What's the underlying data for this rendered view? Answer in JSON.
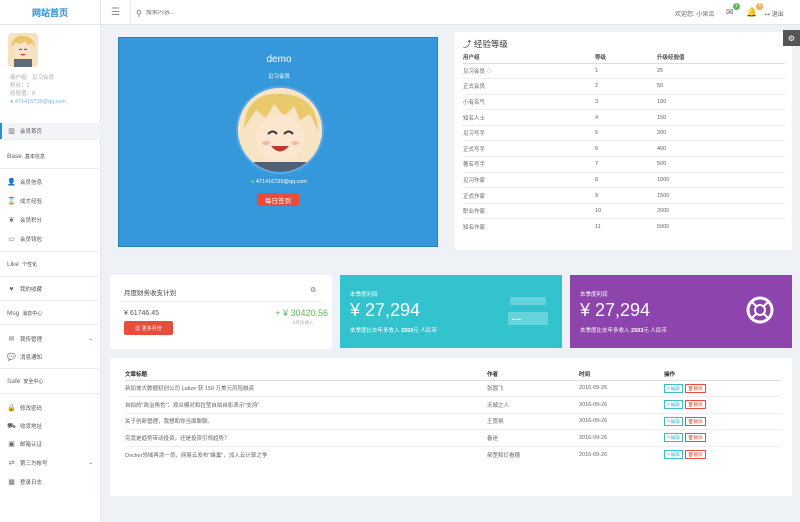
{
  "topbar": {
    "logo": "网站首页",
    "search_placeholder": "搜索内容...",
    "welcome": "欢迎您: 小呆瓜",
    "msg_count": "1",
    "notice_count": "5",
    "logout": "退出"
  },
  "sidebar": {
    "user": {
      "role": "用户组：见习会员",
      "score": "积分：1",
      "exp": "经验值：8",
      "email": "471416739@qq.com"
    },
    "home": "会员首页",
    "groups": [
      {
        "title": "Base",
        "sub": "基本信息",
        "items": [
          "会员信息",
          "成才经验",
          "会员积分",
          "会员钱包"
        ]
      },
      {
        "title": "Like",
        "sub": "个性化",
        "items": [
          "我的收藏"
        ]
      },
      {
        "title": "Msg",
        "sub": "消息中心",
        "items": [
          "我传管理",
          "消息通知"
        ]
      },
      {
        "title": "Safe",
        "sub": "安全中心",
        "items": [
          "修改密码",
          "收货地址",
          "邮箱认证",
          "第三方帐号",
          "登录日志"
        ]
      }
    ]
  },
  "profile": {
    "name": "demo",
    "level": "见习会员",
    "email": "471416739@qq.com",
    "sign_button": "每日签到"
  },
  "exp_table": {
    "title": "经验等级",
    "headers": [
      "用户组",
      "等级",
      "升级经验值"
    ],
    "rows": [
      [
        "见习会员",
        "1",
        "25"
      ],
      [
        "正式会员",
        "2",
        "50"
      ],
      [
        "小有名气",
        "3",
        "100"
      ],
      [
        "知名人士",
        "4",
        "150"
      ],
      [
        "见习写手",
        "5",
        "200"
      ],
      [
        "正式写手",
        "6",
        "400"
      ],
      [
        "著名写手",
        "7",
        "500"
      ],
      [
        "见习作家",
        "8",
        "1000"
      ],
      [
        "正式作家",
        "9",
        "1500"
      ],
      [
        "职业作家",
        "10",
        "2000"
      ],
      [
        "知名作家",
        "11",
        "5000"
      ]
    ]
  },
  "finance": {
    "title": "月度财务收支计划",
    "value1": "¥ 61746.45",
    "value2": "+ ¥ 30420.56",
    "note": "8月份收入",
    "button": "更多月份"
  },
  "cards": [
    {
      "label": "本季度利润",
      "amount": "¥ 27,294",
      "compare_prefix": "本季度比去年多收入",
      "compare_value": "2593",
      "compare_suffix": "元 人民币",
      "color": "#33c3cf"
    },
    {
      "label": "本季度利润",
      "amount": "¥ 27,294",
      "compare_prefix": "本季度比去年多收入",
      "compare_value": "2593",
      "compare_suffix": "元 人民币",
      "color": "#8e44ad"
    }
  ],
  "articles": {
    "headers": [
      "文章标题",
      "作者",
      "时间",
      "操作"
    ],
    "edit": "编辑",
    "delete": "删除",
    "rows": [
      [
        "新加坡大数据初创公司 Latize 获 150 万美元风险融资",
        "张圆飞",
        "2016-09-26"
      ],
      [
        "自拍的\"政治角色\"：观众模对和拉莹自拍自影表示\"支持\"",
        "天城之人",
        "2016-09-26"
      ],
      [
        "关于创新管理，我想和你当面聊聊。",
        "王宽柄",
        "2016-09-26"
      ],
      [
        "究竟是趋势带动投资，还是投资引领趋势？",
        "春迷",
        "2016-09-26"
      ],
      [
        "Docker领域再添一员，网易云发布\"蜂巢\"，加入云计算之争",
        "郝罡和灯看穗",
        "2016-09-26"
      ]
    ]
  }
}
